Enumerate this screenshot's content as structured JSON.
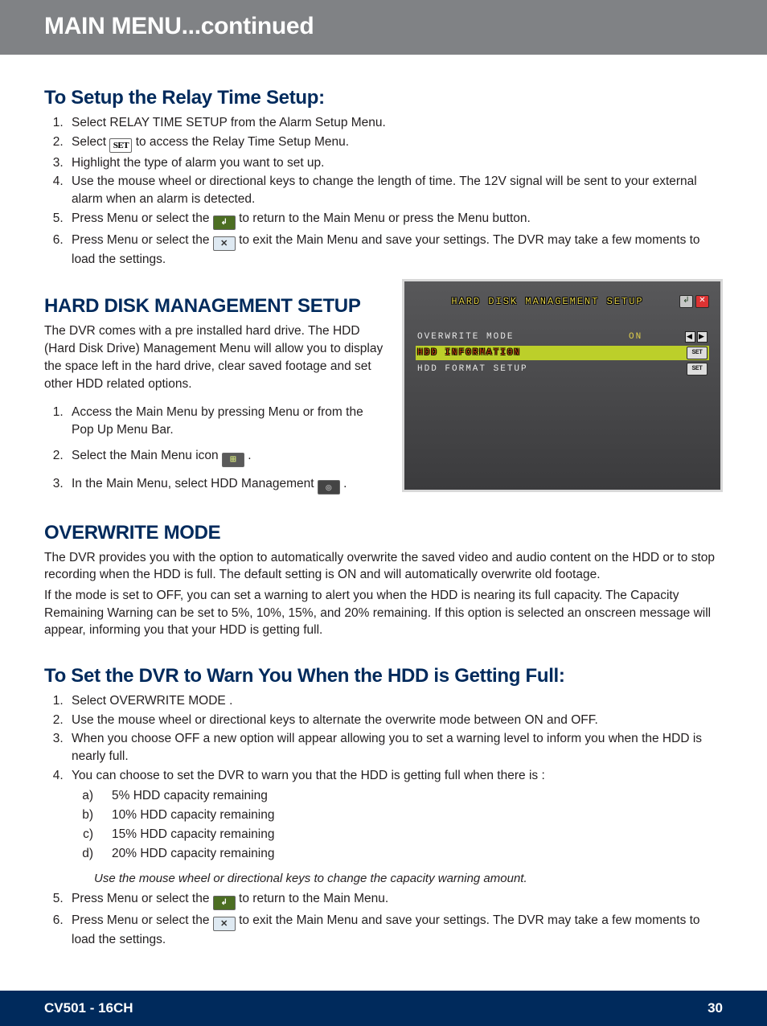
{
  "header": {
    "title": "MAIN MENU...continued"
  },
  "section1": {
    "heading": "To Setup the Relay Time Setup:",
    "steps": {
      "s1": "Select RELAY TIME SETUP from the Alarm Setup Menu.",
      "s2a": "Select ",
      "s2_icon": "SET",
      "s2b": " to access the Relay Time Setup Menu.",
      "s3": "Highlight the type of alarm you want to set up.",
      "s4": "Use the mouse wheel or directional keys to change the length of time. The 12V signal will be sent to your external alarm when an alarm is detected.",
      "s5a": "Press Menu or select the ",
      "s5b": " to return to the Main Menu or press the Menu button.",
      "s6a": "Press Menu or select the ",
      "s6b": " to exit the Main Menu and save your settings. The DVR may take a few moments to load the settings."
    }
  },
  "section2": {
    "heading": "HARD DISK MANAGEMENT SETUP",
    "para": "The DVR comes with a pre installed hard drive. The HDD (Hard Disk Drive) Management Menu will allow you to display the space left in the hard drive, clear saved footage and set other HDD related options.",
    "steps": {
      "s1": "Access the Main Menu by pressing Menu or from the Pop Up Menu Bar.",
      "s2a": "Select the Main Menu icon ",
      "s2b": " .",
      "s3a": "In the Main Menu, select HDD Management ",
      "s3b": " ."
    }
  },
  "dvr": {
    "title": "HARD DISK MANAGEMENT SETUP",
    "row1_label": "OVERWRITE MODE",
    "row1_value": "ON",
    "row2_label": "HDD INFORMATION",
    "row3_label": "HDD FORMAT SETUP",
    "set_label": "SET"
  },
  "section3": {
    "heading": "OVERWRITE MODE",
    "p1": "The DVR provides you with the option to automatically overwrite the saved video and audio content on the HDD or to stop recording when the HDD is full. The default setting is ON and will automatically overwrite old footage.",
    "p2": "If the mode is set to OFF, you can set a warning to alert you when the HDD is nearing its full capacity. The Capacity Remaining Warning can be set to 5%, 10%, 15%, and 20% remaining. If this option is selected an onscreen message will appear, informing you that your HDD is getting full."
  },
  "section4": {
    "heading": "To Set the DVR to Warn You When the HDD is Getting Full:",
    "steps": {
      "s1": "Select OVERWRITE MODE .",
      "s2": "Use the mouse wheel or directional keys to alternate the overwrite mode between ON and OFF.",
      "s3": "When you choose OFF a new option will appear allowing you to set a warning level to inform you when the HDD is nearly full.",
      "s4": "You can choose to set the DVR to warn you that the HDD is getting full when there is :",
      "opts": {
        "a": " 5% HDD capacity remaining",
        "b": "10% HDD capacity remaining",
        "c": "15% HDD capacity remaining",
        "d": "20% HDD capacity remaining"
      },
      "hint": "Use the mouse wheel or directional keys to change the capacity warning amount.",
      "s5a": "Press Menu or select the ",
      "s5b": " to return to the Main Menu.",
      "s6a": "Press Menu or select the ",
      "s6b": " to exit the Main Menu and save your settings. The DVR may take a few moments to load the settings."
    }
  },
  "footer": {
    "model": "CV501 - 16CH",
    "page": "30"
  }
}
